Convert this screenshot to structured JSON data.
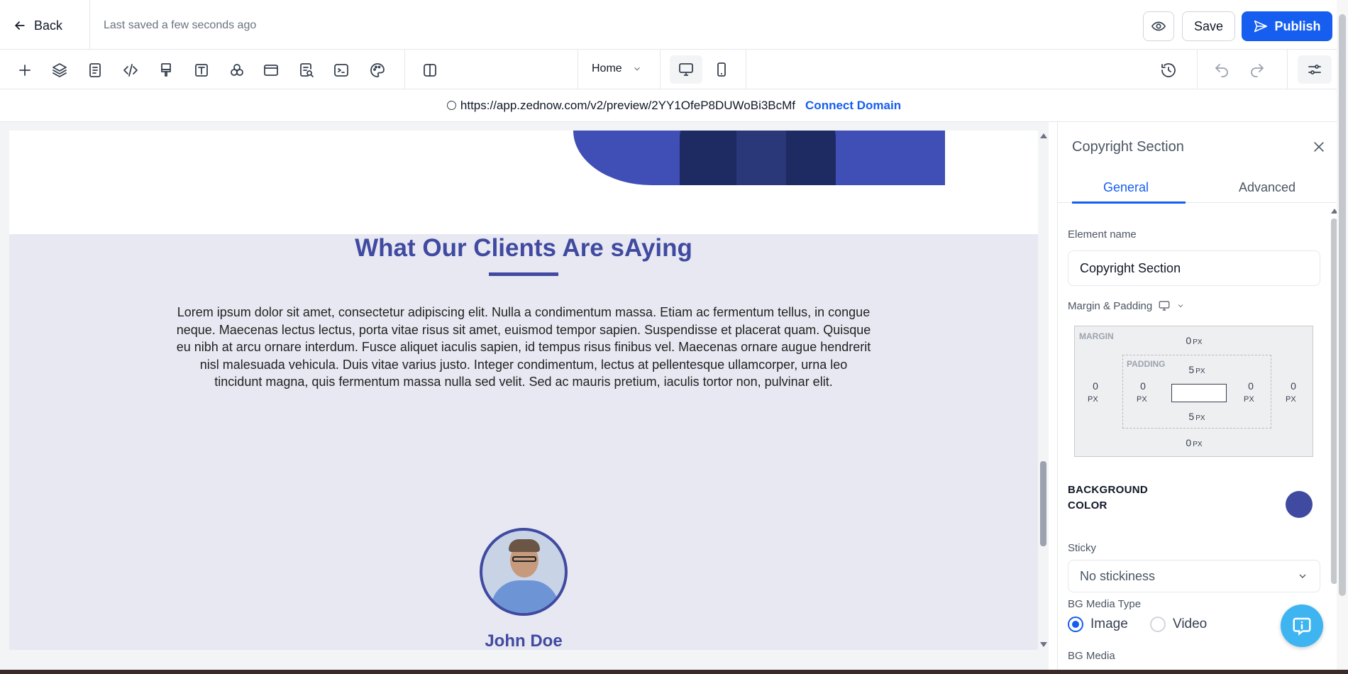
{
  "header": {
    "back_label": "Back",
    "saved_status": "Last saved a few seconds ago",
    "save_label": "Save",
    "publish_label": "Publish"
  },
  "toolbar": {
    "tools": [
      "add-icon",
      "layers-icon",
      "pages-icon",
      "code-icon",
      "paint-brush-icon",
      "text-icon",
      "shapes-icon",
      "section-icon",
      "seo-search-icon",
      "terminal-icon",
      "palette-icon",
      "split-view-icon"
    ],
    "page_selector": "Home",
    "devices": [
      "desktop",
      "mobile"
    ],
    "active_device": "desktop"
  },
  "urlbar": {
    "url": "https://app.zednow.com/v2/preview/2YY1OfeP8DUWoBi3BcMf",
    "connect_label": "Connect Domain"
  },
  "canvas": {
    "heading": "What Our Clients Are sAying",
    "body": "Lorem ipsum dolor sit amet, consectetur adipiscing elit. Nulla a condimentum massa. Etiam ac fermentum tellus, in congue neque. Maecenas lectus lectus, porta vitae risus sit amet, euismod tempor sapien. Suspendisse et placerat quam. Quisque eu nibh at arcu ornare interdum. Fusce aliquet iaculis sapien, id tempus risus finibus vel. Maecenas ornare augue hendrerit nisl malesuada vehicula. Duis vitae varius justo. Integer condimentum, lectus at pellentesque ullamcorper, urna leo tincidunt magna, quis fermentum massa nulla sed velit. Sed ac mauris pretium, iaculis tortor non, pulvinar elit.",
    "client_name": "John Doe",
    "accent_color": "#3f4aa0",
    "section_bg": "#e8e8f2"
  },
  "panel": {
    "title": "Copyright Section",
    "tabs": [
      "General",
      "Advanced"
    ],
    "active_tab": "General",
    "element_name_label": "Element name",
    "element_name_value": "Copyright Section",
    "margin_padding_label": "Margin & Padding",
    "box_model": {
      "margin_label": "MARGIN",
      "padding_label": "PADDING",
      "unit": "PX",
      "margin": {
        "top": "0",
        "right": "0",
        "bottom": "0",
        "left": "0"
      },
      "padding": {
        "top": "5",
        "right": "0",
        "bottom": "5",
        "left": "0"
      }
    },
    "bg_color_label_1": "BACKGROUND",
    "bg_color_label_2": "COLOR",
    "bg_color_value": "#3f4aa0",
    "sticky_label": "Sticky",
    "sticky_value": "No stickiness",
    "bg_media_type_label": "BG Media Type",
    "media_options": [
      "Image",
      "Video"
    ],
    "media_selected": "Image",
    "bg_media_label": "BG Media"
  },
  "colors": {
    "primary": "#155eef",
    "help_fab": "#3eb4f1"
  }
}
